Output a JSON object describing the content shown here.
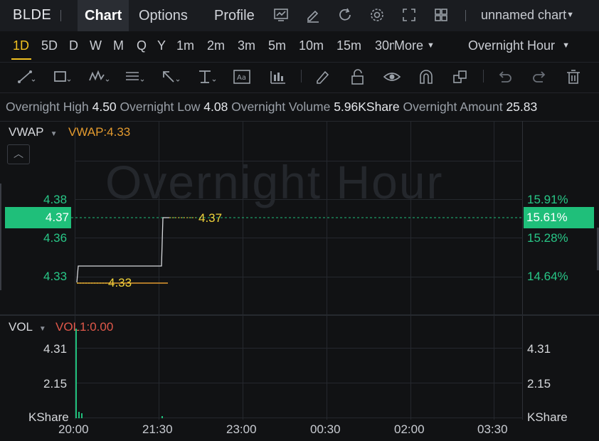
{
  "header": {
    "ticker": "BLDE",
    "tabs": [
      "Chart",
      "Options",
      "Profile"
    ],
    "chart_name": "unnamed chart"
  },
  "timeframes": {
    "items": [
      "1D",
      "5D",
      "D",
      "W",
      "M",
      "Q",
      "Y",
      "1m",
      "2m",
      "3m",
      "5m",
      "10m",
      "15m",
      "30m"
    ],
    "more_label": "More",
    "active": "1D",
    "session": "Overnight Hour"
  },
  "stats": {
    "high_label": "Overnight High",
    "high": "4.50",
    "low_label": "Overnight Low",
    "low": "4.08",
    "volume_label": "Overnight Volume",
    "volume": "5.96KShare",
    "amount_label": "Overnight Amount",
    "amount": "25.83"
  },
  "main_chart": {
    "indicator": "VWAP",
    "indicator_value": "VWAP:4.33",
    "watermark": "Overnight Hour",
    "left_ticks": [
      "4.38",
      "4.36",
      "4.33"
    ],
    "right_ticks": [
      "15.91%",
      "15.28%",
      "14.64%"
    ],
    "current_price": "4.37",
    "current_pct": "15.61%",
    "last_price_label": "4.37",
    "vwap_label": "4.33"
  },
  "volume_chart": {
    "indicator": "VOL",
    "indicator_value": "VOL1:0.00",
    "left_ticks": [
      "4.31",
      "2.15",
      "KShare"
    ],
    "right_ticks": [
      "4.31",
      "2.15",
      "KShare"
    ]
  },
  "x_axis": [
    "20:00",
    "21:30",
    "23:00",
    "00:30",
    "02:00",
    "03:30"
  ],
  "colors": {
    "up": "#1fbf7a",
    "vwap": "#e39a2e",
    "price_line": "#d6d8dc",
    "vol": "#e0584a",
    "active_tf": "#f0c020",
    "last_label": "#f0d23a"
  },
  "icons": [
    "chart-icon",
    "edit-icon",
    "refresh-icon",
    "settings-icon",
    "fullscreen-icon",
    "layout-icon",
    "trendline-icon",
    "rectangle-icon",
    "wave-icon",
    "fib-icon",
    "arrow-icon",
    "measure-icon",
    "text-icon",
    "bar-pattern-icon",
    "pen-icon",
    "lock-icon",
    "eye-icon",
    "magnet-icon",
    "layers-icon",
    "undo-icon",
    "redo-icon",
    "trash-icon"
  ]
}
